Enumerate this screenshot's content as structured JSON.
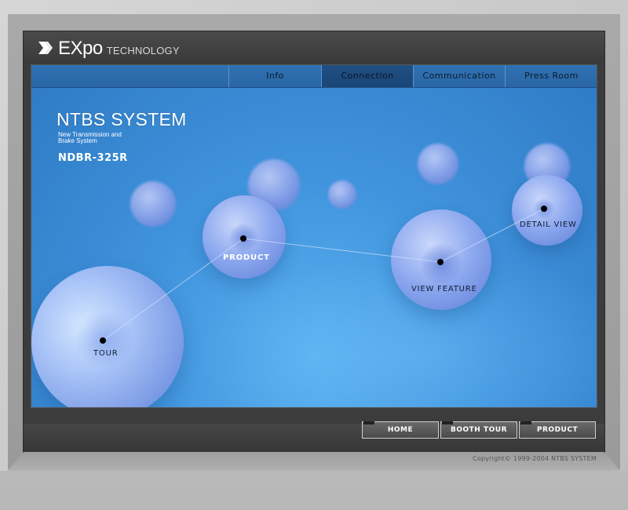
{
  "brand": {
    "logo_main": "EXpo",
    "logo_sub": "TECHNOLOGY",
    "logo_icon": "double-chevron-logo-icon"
  },
  "nav": {
    "items": [
      {
        "label": "Info",
        "active": false
      },
      {
        "label": "Connection",
        "active": true
      },
      {
        "label": "Communication",
        "active": false
      },
      {
        "label": "Press Room",
        "active": false
      }
    ]
  },
  "hero": {
    "title": "NTBS SYSTEM",
    "subtitle_line1": "New Transmission and",
    "subtitle_line2": "Brake System",
    "model": "NDBR-325R"
  },
  "hotspots": {
    "tour": "TOUR",
    "product": "PRODUCT",
    "view_feature": "VIEW FEATURE",
    "detail_view": "DETAIL VIEW"
  },
  "footer": {
    "buttons": [
      "HOME",
      "BOOTH TOUR",
      "PRODUCT"
    ],
    "copyright": "Copyright© 1999-2004 NTBS SYSTEM"
  },
  "colors": {
    "stage_blue": "#3f93dc",
    "nav_blue": "#2f72b2",
    "nav_active": "#1f4f84",
    "panel_dark": "#3c3c3c"
  }
}
